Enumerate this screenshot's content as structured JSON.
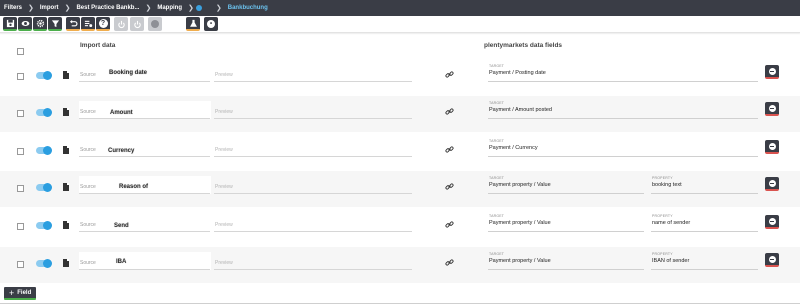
{
  "breadcrumb": {
    "items": [
      "Filters",
      "Import",
      "Best Practice Bankb...",
      "Mapping",
      "Bankbuchung"
    ]
  },
  "toolbar": {
    "buttons": [
      {
        "icon": "save-icon",
        "state": "enabled",
        "accent": "#4cae4c"
      },
      {
        "icon": "eye-icon",
        "state": "enabled",
        "accent": "#4cae4c"
      },
      {
        "icon": "gear-icon",
        "state": "enabled",
        "accent": "#4cae4c"
      },
      {
        "icon": "filter-icon",
        "state": "enabled",
        "accent": "#4cae4c"
      },
      {
        "icon": "undo-icon",
        "state": "enabled",
        "accent": "#f0ad4e"
      },
      {
        "icon": "list-settings-icon",
        "state": "enabled",
        "accent": "#f0ad4e"
      },
      {
        "icon": "help-icon",
        "state": "enabled",
        "accent": "#f0ad4e"
      },
      {
        "icon": "power-icon",
        "state": "disabled"
      },
      {
        "icon": "power-off-icon",
        "state": "disabled"
      },
      {
        "icon": "stop-icon",
        "state": "disabled"
      },
      {
        "icon": "flask-icon",
        "state": "enabled",
        "accent": "#f0ad4e"
      },
      {
        "icon": "info-icon",
        "state": "enabled"
      }
    ]
  },
  "columns": {
    "import_title": "Import data",
    "target_title": "plentymarkets data fields"
  },
  "labels": {
    "source": "Source",
    "preview": "Preview",
    "target": "TARGET",
    "property": "PROPERTY"
  },
  "rows": [
    {
      "source_value": "Booking date",
      "target_value": "Payment / Posting date",
      "property_value": null
    },
    {
      "source_value": "Amount",
      "target_value": "Payment / Amount posted",
      "property_value": null
    },
    {
      "source_value": "Currency",
      "target_value": "Payment / Currency",
      "property_value": null
    },
    {
      "source_value": "Reason of",
      "target_value": "Payment property / Value",
      "property_value": "booking text"
    },
    {
      "source_value": "Send",
      "target_value": "Payment property / Value",
      "property_value": "name of sender"
    },
    {
      "source_value": "IBA",
      "target_value": "Payment property / Value",
      "property_value": "IBAN of sender"
    }
  ],
  "add_field_label": "Field",
  "colors": {
    "dark": "#3a3d46",
    "accent_blue": "#2a9ee0",
    "active_crumb": "#6cc3ef",
    "green": "#4cae4c",
    "yellow": "#f0ad4e",
    "red": "#d9534f"
  }
}
